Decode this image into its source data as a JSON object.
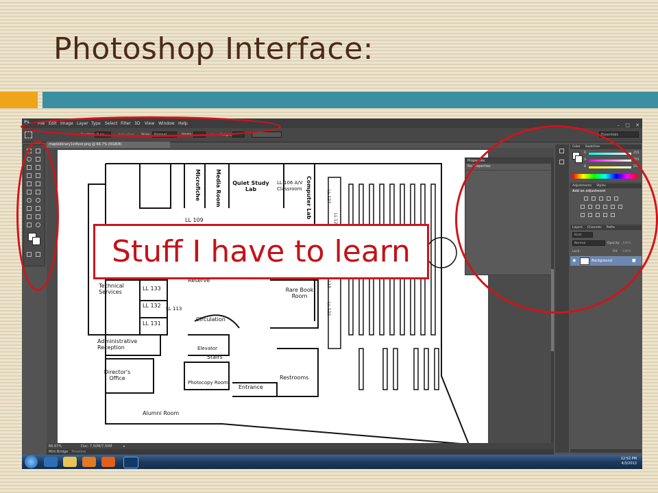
{
  "slide": {
    "title": "Photoshop Interface:",
    "callout": "Stuff I have to learn"
  },
  "colors": {
    "title": "#4a2b18",
    "accent_orange": "#f0a419",
    "accent_teal": "#3b8fa0",
    "callout_red": "#c41218"
  },
  "app": {
    "logo": "Ps",
    "menu": [
      "File",
      "Edit",
      "Image",
      "Layer",
      "Type",
      "Select",
      "Filter",
      "3D",
      "View",
      "Window",
      "Help"
    ],
    "options": {
      "feather_label": "Feather:",
      "feather_value": "0 px",
      "antialias": "Anti-alias",
      "style_label": "Style:",
      "style_value": "Normal",
      "width_label": "Width:",
      "height_label": "Height:",
      "workspace": "Essentials"
    },
    "document_tab": "maplelibrary1stfloor.png @ 66.7% (RGB/8)",
    "status": {
      "zoom": "66.67%",
      "doc": "Doc: 7.50M/7.50M"
    },
    "bottom_tabs": [
      "Mini Bridge",
      "Timeline"
    ],
    "properties_panel": {
      "title": "Properties",
      "subtitle": "No Properties"
    },
    "right_panels": {
      "color_tabs": [
        "Color",
        "Swatches"
      ],
      "rgb": [
        {
          "ch": "R",
          "val": "255"
        },
        {
          "ch": "G",
          "val": "255"
        },
        {
          "ch": "B",
          "val": "255"
        }
      ],
      "adjust_tabs": [
        "Adjustments",
        "Styles"
      ],
      "adjust_label": "Add an adjustment",
      "layer_tabs": [
        "Layers",
        "Channels",
        "Paths"
      ],
      "kind": "Kind",
      "blend": "Normal",
      "opacity_label": "Opacity:",
      "opacity": "100%",
      "lock_label": "Lock:",
      "fill_label": "Fill:",
      "fill": "100%",
      "layer_name": "Background"
    },
    "tray": {
      "time": "12:52 PM",
      "date": "4/3/2013"
    }
  },
  "floorplan": {
    "labels": [
      "Microfiche",
      "Media Room",
      "Quiet Study Lab",
      "LL 106 A/V Classroom",
      "Computer Lab",
      "LL 109",
      "Technical Services",
      "LL 133",
      "LL 132",
      "LL 113",
      "LL 131",
      "Reserve",
      "Circulation",
      "Rare Book Room",
      "Administrative Reception",
      "Elevator",
      "Stairs",
      "Director's Office",
      "Photocopy Room",
      "Entrance",
      "Restrooms",
      "Alumni Room",
      "LL 127",
      "LL 126",
      "123",
      "LL 122"
    ]
  }
}
